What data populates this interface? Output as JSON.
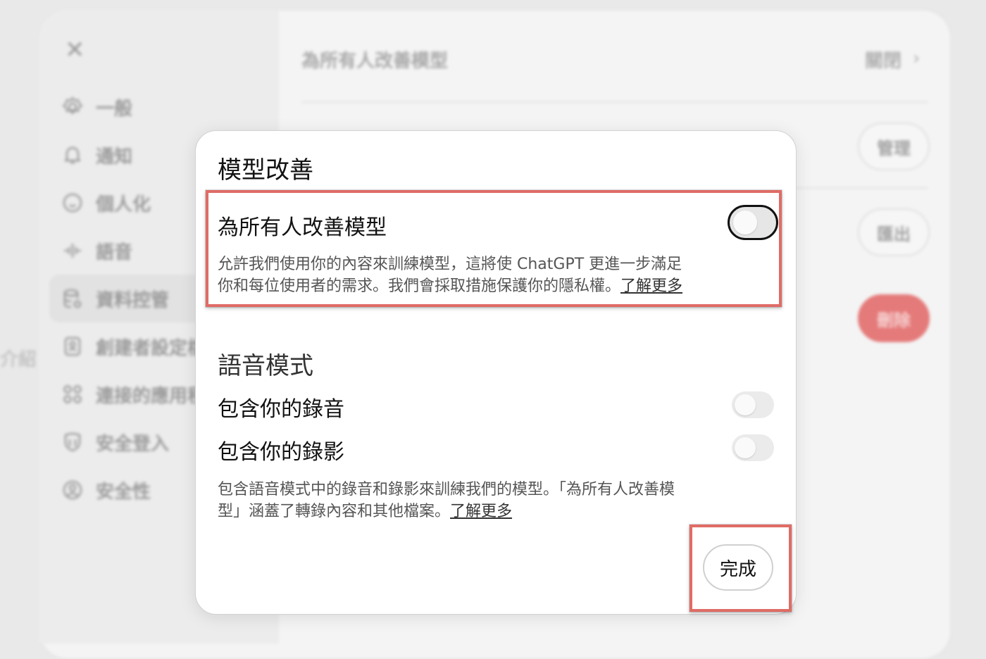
{
  "background": {
    "sidebar": {
      "close_label": "✕",
      "items": [
        {
          "label": "一般",
          "icon": "gear-icon"
        },
        {
          "label": "通知",
          "icon": "bell-icon"
        },
        {
          "label": "個人化",
          "icon": "personalize-icon"
        },
        {
          "label": "語音",
          "icon": "voice-wave-icon"
        },
        {
          "label": "資料控管",
          "icon": "database-icon",
          "active": true
        },
        {
          "label": "創建者設定檔",
          "icon": "profile-card-icon"
        },
        {
          "label": "連接的應用程式",
          "icon": "apps-icon"
        },
        {
          "label": "安全登入",
          "icon": "shield-key-icon"
        },
        {
          "label": "安全性",
          "icon": "security-icon"
        }
      ]
    },
    "left_edge_text": "介紹",
    "main": {
      "row_title": "為所有人改善模型",
      "row_value": "關閉",
      "manage_label": "管理",
      "export_label": "匯出",
      "delete_label": "刪除"
    }
  },
  "dialog": {
    "title": "模型改善",
    "improve": {
      "title": "為所有人改善模型",
      "desc_line1": "允許我們使用你的內容來訓練模型，這將使 ChatGPT 更進一步滿足",
      "desc_line2": "你和每位使用者的需求。我們會採取措施保護你的隱私權。",
      "learn_more": "了解更多",
      "enabled": false
    },
    "voice": {
      "title": "語音模式",
      "audio_label": "包含你的錄音",
      "audio_enabled": false,
      "video_label": "包含你的錄影",
      "video_enabled": false,
      "desc_line1": "包含語音模式中的錄音和錄影來訓練我們的模型。「為所有人改善模",
      "desc_line2": "型」涵蓋了轉錄內容和其他檔案。",
      "learn_more": "了解更多"
    },
    "done_label": "完成"
  },
  "colors": {
    "highlight": "#e06c66",
    "danger": "#e57a7a"
  }
}
